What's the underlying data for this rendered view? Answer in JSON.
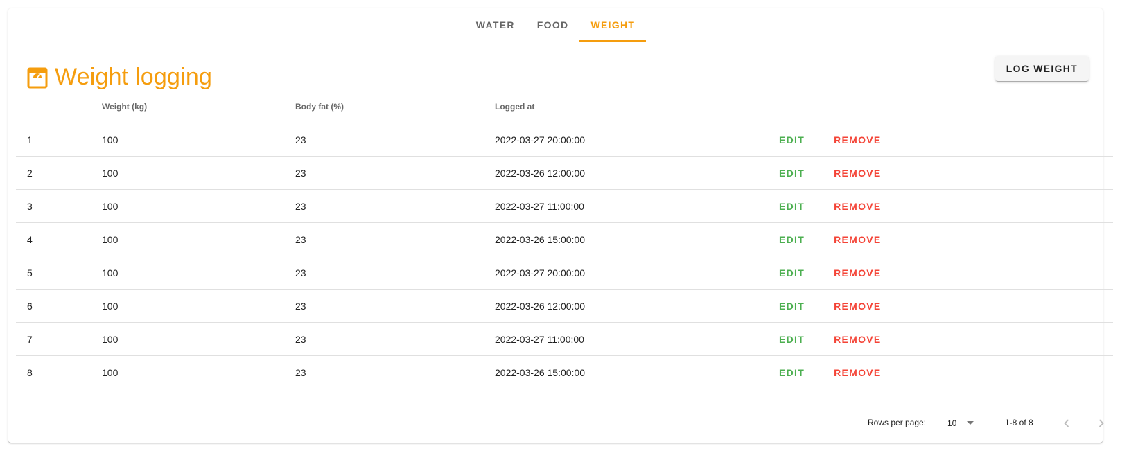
{
  "tabs": [
    {
      "label": "WATER"
    },
    {
      "label": "FOOD"
    },
    {
      "label": "WEIGHT"
    }
  ],
  "active_tab": "WEIGHT",
  "header": {
    "title": "Weight logging",
    "icon": "scale-icon",
    "log_button": "LOG WEIGHT"
  },
  "table": {
    "headers": {
      "index": "",
      "weight": "Weight (kg)",
      "body_fat": "Body fat (%)",
      "logged_at": "Logged at"
    },
    "rows": [
      {
        "index": "1",
        "weight": "100",
        "body_fat": "23",
        "logged_at": "2022-03-27 20:00:00",
        "edit": "EDIT",
        "remove": "REMOVE"
      },
      {
        "index": "2",
        "weight": "100",
        "body_fat": "23",
        "logged_at": "2022-03-26 12:00:00",
        "edit": "EDIT",
        "remove": "REMOVE"
      },
      {
        "index": "3",
        "weight": "100",
        "body_fat": "23",
        "logged_at": "2022-03-27 11:00:00",
        "edit": "EDIT",
        "remove": "REMOVE"
      },
      {
        "index": "4",
        "weight": "100",
        "body_fat": "23",
        "logged_at": "2022-03-26 15:00:00",
        "edit": "EDIT",
        "remove": "REMOVE"
      },
      {
        "index": "5",
        "weight": "100",
        "body_fat": "23",
        "logged_at": "2022-03-27 20:00:00",
        "edit": "EDIT",
        "remove": "REMOVE"
      },
      {
        "index": "6",
        "weight": "100",
        "body_fat": "23",
        "logged_at": "2022-03-26 12:00:00",
        "edit": "EDIT",
        "remove": "REMOVE"
      },
      {
        "index": "7",
        "weight": "100",
        "body_fat": "23",
        "logged_at": "2022-03-27 11:00:00",
        "edit": "EDIT",
        "remove": "REMOVE"
      },
      {
        "index": "8",
        "weight": "100",
        "body_fat": "23",
        "logged_at": "2022-03-26 15:00:00",
        "edit": "EDIT",
        "remove": "REMOVE"
      }
    ]
  },
  "pagination": {
    "rows_per_page_label": "Rows per page:",
    "rows_per_page_value": "10",
    "range": "1-8 of 8"
  },
  "colors": {
    "accent": "#f59d0e",
    "edit": "#4caf50",
    "remove": "#f44336"
  }
}
